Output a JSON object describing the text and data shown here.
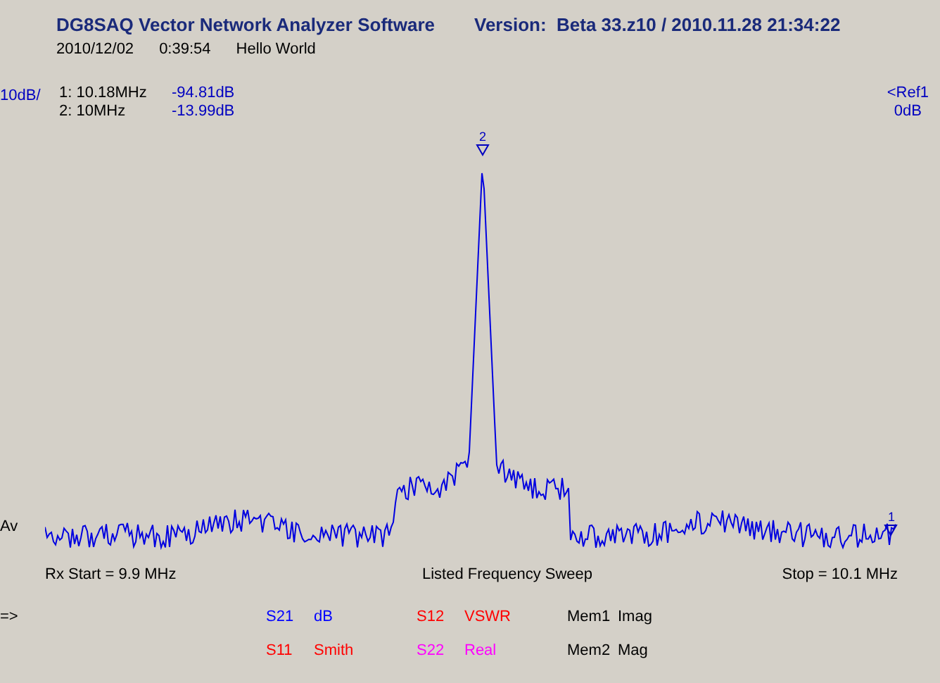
{
  "window": {
    "title": "DG8SAQ Vector Network Analyzer Software",
    "version": "Version:  Beta 33.z10 / 2010.11.28 21:34:22"
  },
  "info": {
    "date": "2010/12/02",
    "time": "0:39:54",
    "comment": "Hello World"
  },
  "scale": "10dB/",
  "reference": {
    "line1": "<Ref1",
    "line2": "0dB"
  },
  "markers": [
    {
      "label": "1: 10.18MHz",
      "value": "-94.81dB",
      "tag": "1"
    },
    {
      "label": "2: 10MHz",
      "value": "-13.99dB",
      "tag": "2"
    }
  ],
  "trace_label": "Av",
  "sweep": {
    "start": "Rx Start = 9.9 MHz",
    "mode": "Listed Frequency Sweep",
    "stop": "Stop = 10.1 MHz"
  },
  "prompt": "=>",
  "legend": [
    [
      {
        "param": "S21",
        "format": "dB",
        "color": "#0000ff"
      },
      {
        "param": "S12",
        "format": "VSWR",
        "color": "#ff0000"
      },
      {
        "param": "Mem1",
        "format": "Imag",
        "color": "#000000"
      }
    ],
    [
      {
        "param": "S11",
        "format": "Smith",
        "color": "#ff0000"
      },
      {
        "param": "S22",
        "format": "Real",
        "color": "#ff00ff"
      },
      {
        "param": "Mem2",
        "format": "Mag",
        "color": "#000000"
      }
    ]
  ]
}
